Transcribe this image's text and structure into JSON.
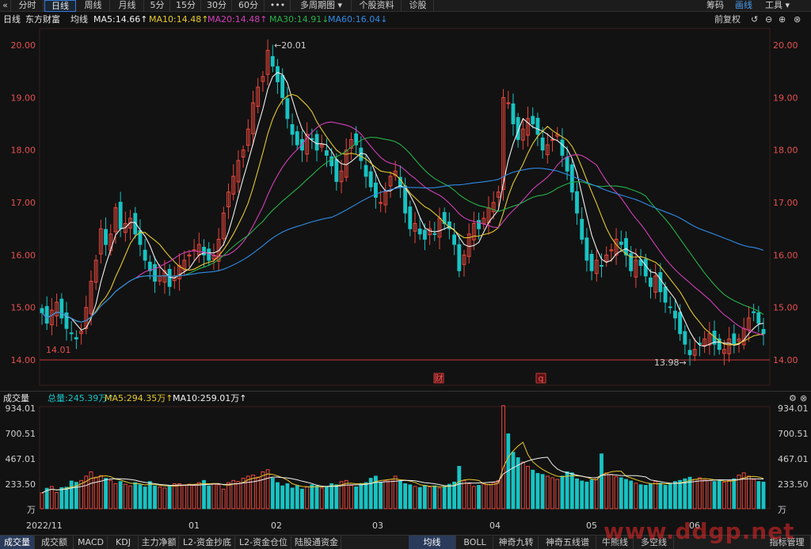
{
  "toolbar": {
    "back_icon": "chevron-left-icon",
    "periods": [
      "分时",
      "日线",
      "周线",
      "月线",
      "5分",
      "15分",
      "30分",
      "60分"
    ],
    "active_period": "日线",
    "more_label": "•••",
    "multi_period_label": "多周期图",
    "stock_info_label": "个股资料",
    "diagnose_label": "诊股",
    "chips_label": "筹码",
    "draw_label": "画线",
    "tools_label": "工具"
  },
  "header": {
    "period": "日线",
    "stock_name": "东方财富",
    "ma_label": "均线",
    "ma5": "MA5:14.66↑",
    "ma10": "MA10:14.48↑",
    "ma20": "MA20:14.48↑",
    "ma30": "MA30:14.91↓",
    "ma60": "MA60:16.04↓",
    "adjust": "前复权"
  },
  "volume_header": {
    "title": "成交量",
    "total": "总量:245.39万↑",
    "ma5": "MA5:294.35万↑",
    "ma10": "MA10:259.01万↑"
  },
  "colors": {
    "up": "#e8473c",
    "down": "#19c3c3",
    "ma5": "#f0f0f0",
    "ma10": "#e5c92e",
    "ma20": "#d23fb7",
    "ma30": "#27b14a",
    "ma60": "#2f8be6",
    "axis_text": "#e64f4f"
  },
  "bottom_tabs": [
    "成交量",
    "成交额",
    "MACD",
    "KDJ",
    "主力净额",
    "L2-资金抄底",
    "L2-资金仓位",
    "陆股通资金",
    "均线",
    "BOLL",
    "神奇九转",
    "神奇五线谱",
    "牛熊线",
    "多空线",
    "指标管理"
  ],
  "active_bottom_tab": "成交量",
  "active_overlay_tab": "均线",
  "watermark": "www.ddgp.net",
  "chart_data": [
    {
      "type": "candlestick",
      "price_ticks": [
        "20.00",
        "19.00",
        "18.00",
        "17.00",
        "16.00",
        "15.00",
        "14.00"
      ],
      "ylim": [
        14.0,
        20.0
      ],
      "x_tick_labels": [
        "2022/11",
        "01",
        "02",
        "03",
        "04",
        "05",
        "06"
      ],
      "annotations": {
        "high": "20.01",
        "low": "13.98",
        "first_low": "14.01",
        "marker_fin": "财",
        "marker_q": "q"
      },
      "reference_line": 14.0,
      "closes": [
        14.9,
        14.7,
        14.95,
        15.1,
        14.8,
        14.6,
        14.5,
        14.4,
        14.55,
        15.0,
        15.5,
        15.9,
        16.5,
        16.2,
        16.4,
        16.9,
        16.5,
        16.6,
        16.7,
        16.4,
        16.2,
        15.9,
        15.7,
        15.5,
        15.6,
        15.7,
        15.4,
        15.6,
        15.8,
        15.9,
        16.0,
        16.1,
        16.2,
        16.0,
        15.9,
        16.0,
        16.3,
        16.8,
        17.2,
        17.5,
        17.8,
        18.0,
        18.4,
        18.9,
        19.2,
        19.4,
        19.9,
        19.6,
        19.3,
        19.0,
        18.6,
        18.3,
        18.1,
        18.0,
        18.3,
        18.2,
        18.0,
        18.1,
        17.9,
        17.7,
        17.4,
        17.6,
        18.0,
        18.2,
        18.1,
        17.8,
        17.5,
        17.3,
        17.1,
        17.0,
        17.2,
        17.5,
        17.6,
        17.3,
        16.8,
        16.5,
        16.6,
        16.4,
        16.3,
        16.5,
        16.4,
        16.7,
        16.6,
        16.5,
        16.2,
        15.7,
        16.0,
        16.4,
        16.6,
        16.5,
        16.7,
        16.9,
        17.0,
        17.2,
        19.0,
        18.9,
        18.5,
        18.2,
        18.4,
        18.6,
        18.5,
        18.3,
        18.0,
        18.1,
        18.2,
        18.3,
        17.9,
        17.6,
        17.2,
        16.8,
        16.3,
        15.9,
        15.7,
        15.9,
        15.8,
        16.0,
        16.1,
        16.3,
        16.2,
        16.0,
        15.7,
        15.9,
        15.8,
        15.6,
        15.4,
        15.6,
        15.3,
        15.1,
        15.0,
        14.8,
        14.5,
        14.3,
        14.1,
        14.2,
        14.3,
        14.4,
        14.5,
        14.3,
        14.2,
        14.2,
        14.4,
        14.3,
        14.4,
        14.6,
        14.8,
        14.9,
        14.7,
        14.5
      ],
      "series": [
        {
          "name": "MA5",
          "values": [
            14.66
          ]
        },
        {
          "name": "MA10",
          "values": [
            14.48
          ]
        },
        {
          "name": "MA20",
          "values": [
            14.48
          ]
        },
        {
          "name": "MA30",
          "values": [
            14.91
          ]
        },
        {
          "name": "MA60",
          "values": [
            16.04
          ]
        }
      ]
    },
    {
      "type": "bar",
      "unit": "万",
      "y_ticks": [
        "934.01",
        "700.51",
        "467.01",
        "233.50",
        "万"
      ],
      "ylim": [
        0,
        934.01
      ],
      "last_volume": 245.39,
      "ma5": 294.35,
      "ma10": 259.01,
      "values": [
        145,
        188,
        205,
        150,
        194,
        198,
        255,
        243,
        260,
        300,
        340,
        290,
        305,
        280,
        260,
        230,
        250,
        225,
        210,
        240,
        220,
        200,
        250,
        210,
        200,
        190,
        210,
        230,
        230,
        220,
        225,
        215,
        240,
        260,
        210,
        230,
        220,
        180,
        240,
        260,
        250,
        280,
        300,
        310,
        290,
        340,
        360,
        280,
        240,
        210,
        230,
        190,
        210,
        180,
        200,
        220,
        210,
        190,
        205,
        230,
        220,
        250,
        260,
        215,
        200,
        230,
        240,
        280,
        300,
        245,
        260,
        270,
        300,
        255,
        230,
        220,
        205,
        195,
        215,
        200,
        210,
        190,
        205,
        225,
        245,
        390,
        260,
        230,
        205,
        215,
        230,
        225,
        240,
        260,
        950,
        690,
        520,
        470,
        430,
        390,
        355,
        325,
        315,
        300,
        285,
        270,
        300,
        340,
        330,
        275,
        255,
        245,
        265,
        285,
        505,
        330,
        315,
        295,
        285,
        270,
        255,
        235,
        220,
        215,
        230,
        250,
        235,
        215,
        230,
        250,
        260,
        275,
        290,
        270,
        285,
        265,
        260,
        250,
        255,
        245,
        260,
        275,
        310,
        330,
        300,
        270,
        250,
        245
      ]
    }
  ]
}
